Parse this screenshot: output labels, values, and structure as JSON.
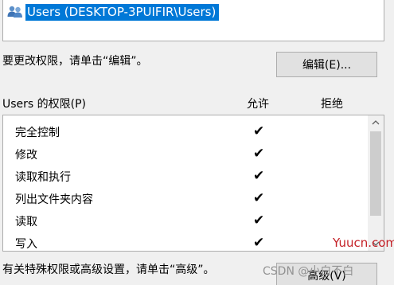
{
  "group": {
    "selected_label": "Users (DESKTOP-3PUIFIR\\Users)",
    "icon": "users-group-icon"
  },
  "change_hint": "要更改权限，请单击“编辑”。",
  "edit_button": "编辑(E)...",
  "permissions": {
    "header": "Users 的权限(P)",
    "allow_header": "允许",
    "deny_header": "拒绝",
    "rows": [
      {
        "name": "完全控制",
        "allow": "✔",
        "deny": ""
      },
      {
        "name": "修改",
        "allow": "✔",
        "deny": ""
      },
      {
        "name": "读取和执行",
        "allow": "✔",
        "deny": ""
      },
      {
        "name": "列出文件夹内容",
        "allow": "✔",
        "deny": ""
      },
      {
        "name": "读取",
        "allow": "✔",
        "deny": ""
      },
      {
        "name": "写入",
        "allow": "✔",
        "deny": ""
      }
    ]
  },
  "advanced_hint": "有关特殊权限或高级设置，请单击“高级”。",
  "advanced_button": "高级(V)",
  "watermarks": {
    "site": "Yuucn.com",
    "author": "CSDN @小白不白"
  },
  "colors": {
    "selection": "#0078d7",
    "button_bg": "#e1e1e1",
    "window_bg": "#f0f0f0",
    "watermark_red": "#c42026"
  }
}
